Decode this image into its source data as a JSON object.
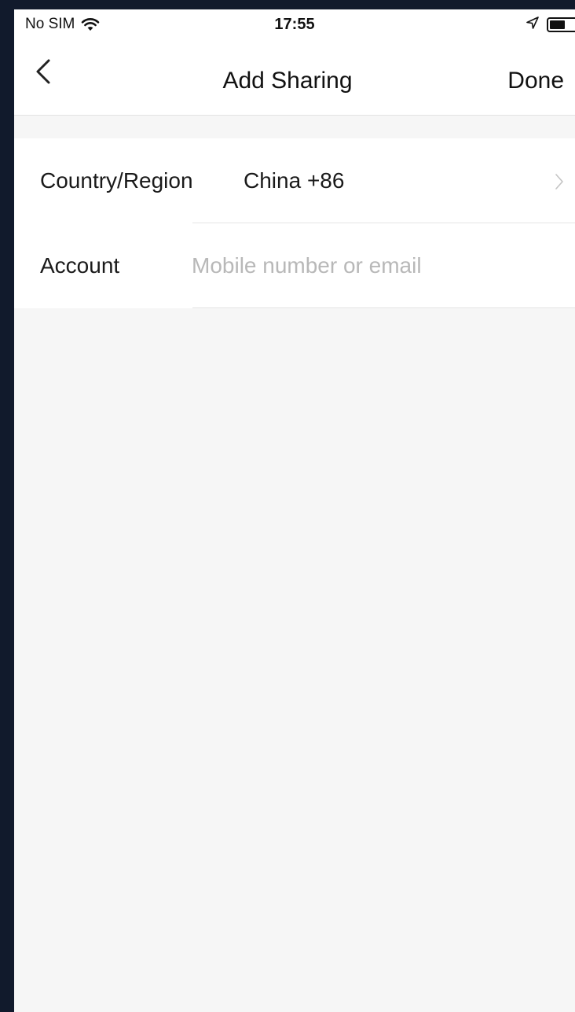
{
  "status_bar": {
    "carrier": "No SIM",
    "time": "17:55",
    "battery_level": 0.55,
    "icons": [
      "wifi-icon",
      "location-arrow-icon",
      "battery-icon"
    ]
  },
  "nav": {
    "title": "Add Sharing",
    "done_label": "Done",
    "back_icon": "chevron-left-icon"
  },
  "form": {
    "country_label": "Country/Region",
    "country_value": "China +86",
    "account_label": "Account",
    "account_value": "",
    "account_placeholder": "Mobile number or email"
  },
  "colors": {
    "background": "#f6f6f6",
    "surface": "#ffffff",
    "text": "#1a1a1a",
    "placeholder": "#b8b8b8",
    "frame": "#111a2c"
  }
}
